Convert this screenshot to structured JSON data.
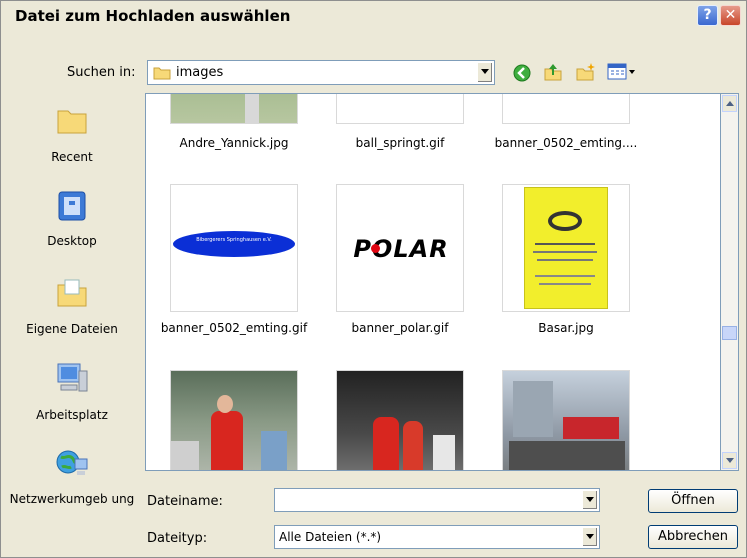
{
  "window": {
    "title": "Datei zum Hochladen auswählen",
    "help_label": "?",
    "close_label": "✕"
  },
  "lookin": {
    "label": "Suchen in:",
    "value": "images"
  },
  "places": [
    {
      "label": "Recent"
    },
    {
      "label": "Desktop"
    },
    {
      "label": "Eigene Dateien"
    },
    {
      "label": "Arbeitsplatz"
    },
    {
      "label": "Netzwerkumgeb ung"
    }
  ],
  "files_top": [
    "Andre_Yannick.jpg",
    "ball_springt.gif",
    "banner_0502_emting...."
  ],
  "files_mid": [
    "banner_0502_emting.gif",
    "banner_polar.gif",
    "Basar.jpg"
  ],
  "thumb_text": {
    "banner_blue": "Bibergerers Springhausen e.V.",
    "polar": "POLAR"
  },
  "filename": {
    "label": "Dateiname:",
    "value": ""
  },
  "filetype": {
    "label": "Dateityp:",
    "value": "Alle Dateien (*.*)"
  },
  "buttons": {
    "open": "Öffnen",
    "cancel": "Abbrechen"
  },
  "colors": {
    "banner_blue": "#0b2fd6",
    "poster_yellow": "#f2ee2c",
    "polar_red": "#e20613"
  }
}
